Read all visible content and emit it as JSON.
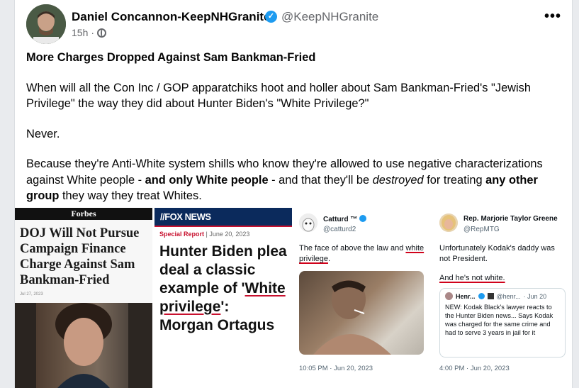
{
  "post": {
    "author_name": "Daniel Concannon-KeepNHGranite",
    "author_handle": "@KeepNHGranite",
    "time": "15h",
    "meta_sep": "·",
    "more": "•••",
    "title": "More Charges Dropped Against Sam Bankman-Fried",
    "para1": "When will all the Con Inc / GOP apparatchiks hoot and holler about Sam Bankman-Fried's \"Jewish Privilege\" the way they did about Hunter Biden's \"White Privilege?\"",
    "para2": "Never.",
    "para3_a": "Because they're Anti-White system shills who know they're allowed to use negative characterizations against White people - ",
    "para3_b": "and only White people",
    "para3_c": " - and that they'll be ",
    "para3_d": "destroyed",
    "para3_e": " for treating ",
    "para3_f": "any other group",
    "para3_g": " they way they treat Whites."
  },
  "images": {
    "forbes": {
      "brand": "Forbes",
      "headline": "DOJ Will Not Pursue Campaign Finance Charge Against Sam Bankman-Fried",
      "date": "Jul 27, 2023"
    },
    "fox": {
      "brand": "FOX NEWS",
      "brand_slash": "//",
      "section": "Special Report",
      "date": " | June 20, 2023",
      "headline_a": "Hunter Biden plea deal a classic example of '",
      "headline_ul": "White privilege",
      "headline_b": "': Morgan Ortagus"
    },
    "catturd": {
      "name": "Catturd ™",
      "handle": "@catturd2",
      "text_a": "The face of above the law and ",
      "text_ul": "white privilege",
      "text_b": ".",
      "time": "10:05 PM · Jun 20, 2023"
    },
    "mtg": {
      "name": "Rep. Marjorie Taylor Greene",
      "handle": "@RepMTG",
      "text1": "Unfortunately Kodak's daddy was not President.",
      "text2": "And he's not white.",
      "quote_name": "Henr...",
      "quote_handle": "@henr...",
      "quote_date": "· Jun 20",
      "quote_text": "NEW: Kodak Black's lawyer reacts to the Hunter Biden news... Says Kodak was charged for the same crime and had to serve 3 years in jail for it",
      "time": "4:00 PM · Jun 20, 2023"
    }
  },
  "colors": {
    "verified": "#1d9bf0",
    "fox_navy": "#0b2a5c",
    "underline_red": "#d0021b"
  }
}
